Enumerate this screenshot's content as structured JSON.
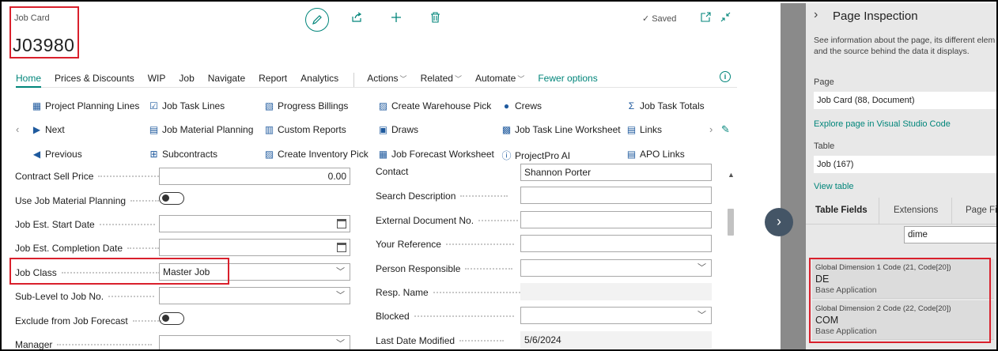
{
  "header": {
    "caption": "Job Card",
    "job_no": "J03980",
    "saved_label": "Saved",
    "icons": [
      "edit-icon",
      "share-icon",
      "add-icon",
      "delete-icon",
      "checkmark-icon",
      "open-new-window-icon",
      "collapse-icon"
    ]
  },
  "menu": {
    "items": [
      "Home",
      "Prices & Discounts",
      "WIP",
      "Job",
      "Navigate",
      "Report",
      "Analytics"
    ],
    "dropdowns": [
      "Actions",
      "Related",
      "Automate"
    ],
    "fewer": "Fewer options"
  },
  "actions": {
    "col1": [
      "Project Planning Lines",
      "Next",
      "Previous"
    ],
    "col2": [
      "Job Task Lines",
      "Job Material Planning",
      "Subcontracts"
    ],
    "col3": [
      "Progress Billings",
      "Custom Reports",
      "Create Inventory Pick"
    ],
    "col4": [
      "Create Warehouse Pick",
      "Draws",
      "Job Forecast Worksheet"
    ],
    "col5": [
      "Crews",
      "Job Task Line Worksheet",
      "ProjectPro AI"
    ],
    "col6": [
      "Job Task Totals",
      "Links",
      "APO Links"
    ]
  },
  "left_fields": {
    "contract_sell_price": {
      "label": "Contract Sell Price",
      "value": "0.00"
    },
    "use_material_planning": {
      "label": "Use Job Material Planning",
      "on": false
    },
    "est_start": {
      "label": "Job Est. Start Date",
      "value": ""
    },
    "est_completion": {
      "label": "Job Est. Completion Date",
      "value": ""
    },
    "job_class": {
      "label": "Job Class",
      "value": "Master Job"
    },
    "sub_level": {
      "label": "Sub-Level to Job No.",
      "value": ""
    },
    "exclude_forecast": {
      "label": "Exclude from Job Forecast",
      "on": false
    },
    "manager": {
      "label": "Manager",
      "value": ""
    }
  },
  "right_fields": {
    "contact": {
      "label": "Contact",
      "value": "Shannon Porter"
    },
    "search_desc": {
      "label": "Search Description",
      "value": ""
    },
    "ext_doc": {
      "label": "External Document No.",
      "value": ""
    },
    "your_ref": {
      "label": "Your Reference",
      "value": ""
    },
    "person_resp": {
      "label": "Person Responsible",
      "value": ""
    },
    "resp_name": {
      "label": "Resp. Name",
      "value": ""
    },
    "blocked": {
      "label": "Blocked",
      "value": ""
    },
    "last_modified": {
      "label": "Last Date Modified",
      "value": "5/6/2024"
    }
  },
  "panel": {
    "title": "Page Inspection",
    "desc_line1": "See information about the page, its different elem",
    "desc_line2": "and the source behind the data it displays.",
    "page_label": "Page",
    "page_value": "Job Card (88, Document)",
    "explore_link": "Explore page in Visual Studio Code",
    "table_label": "Table",
    "table_value": "Job (167)",
    "view_table_link": "View table",
    "tabs": [
      "Table Fields",
      "Extensions",
      "Page Filt"
    ],
    "search_value": "dime",
    "fields": [
      {
        "name": "Global Dimension 1 Code (21, Code[20])",
        "value": "DE",
        "source": "Base Application"
      },
      {
        "name": "Global Dimension 2 Code (22, Code[20])",
        "value": "COM",
        "source": "Base Application"
      }
    ]
  },
  "colors": {
    "accent": "#00857a",
    "highlight": "#d9202c",
    "action_icon": "#1f5a9e"
  }
}
